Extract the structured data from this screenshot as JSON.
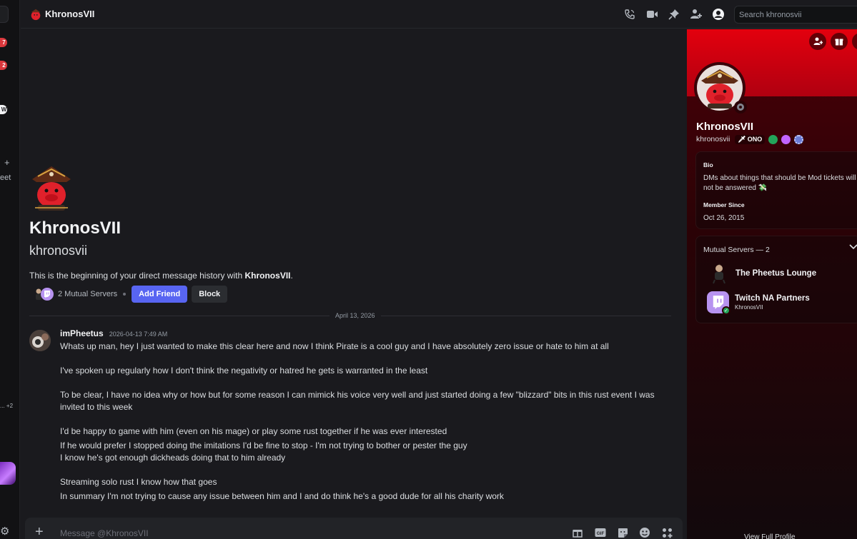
{
  "left_rail": {
    "badges": [
      "7",
      "2",
      "W"
    ],
    "text_fragment": "eet",
    "more_fragment": "... +2",
    "plus": "+"
  },
  "topbar": {
    "title": "KhronosVII",
    "search_placeholder": "Search khronosvii",
    "icons": [
      "voice-call-icon",
      "video-call-icon",
      "pin-icon",
      "add-friends-to-dm-icon",
      "user-profile-icon"
    ]
  },
  "intro": {
    "display_name": "KhronosVII",
    "username": "khronosvii",
    "beginning_prefix": "This is the beginning of your direct message history with ",
    "beginning_name": "KhronosVII",
    "beginning_suffix": ".",
    "mutual_servers": "2 Mutual Servers",
    "add_friend": "Add Friend",
    "block": "Block"
  },
  "divider": {
    "date": "April 13, 2026"
  },
  "message": {
    "author": "imPheetus",
    "timestamp": "2026-04-13 7:49 AM",
    "lines": [
      "Whats up man, hey I just wanted to make this clear here and now I think Pirate is a cool guy and I have absolutely zero issue or hate to him at all",
      "",
      "I've spoken up regularly how I don't think the negativity or hatred he gets is warranted in the least",
      "",
      "To be clear, I have no idea why or how but for some reason I can mimick his voice very well and just started doing a few \"blizzard\" bits in this rust event I was invited to this week",
      "",
      "I'd be happy to game with him (even on his mage) or play some rust together if he was ever interested",
      "If he would prefer I stopped doing the imitations I'd be fine to stop - I'm not trying to bother or pester the guy",
      "I know he's got enough dickheads doing that to him already",
      "",
      "Streaming solo rust I know how that goes",
      "In summary I'm not trying to cause any issue between him and I and do think he's a good dude for all his charity work"
    ]
  },
  "composer": {
    "placeholder": "Message @KhronosVII",
    "icons": [
      "gift-icon",
      "gif-icon",
      "sticker-icon",
      "emoji-icon",
      "apps-icon"
    ]
  },
  "profile": {
    "display_name": "KhronosVII",
    "username": "khronosvii",
    "clan_tag": "ONO",
    "bio_label": "Bio",
    "bio": "DMs about things that should be Mod tickets will not be answered 💸",
    "member_since_label": "Member Since",
    "member_since": "Oct 26, 2015",
    "mutual_servers_label": "Mutual Servers — 2",
    "servers": [
      {
        "name": "The Pheetus Lounge",
        "sub": ""
      },
      {
        "name": "Twitch NA Partners",
        "sub": "KhronosVII"
      }
    ],
    "full_profile": "View Full Profile",
    "colors": {
      "banner": "#e3000e",
      "panel": "#2a0206"
    }
  }
}
